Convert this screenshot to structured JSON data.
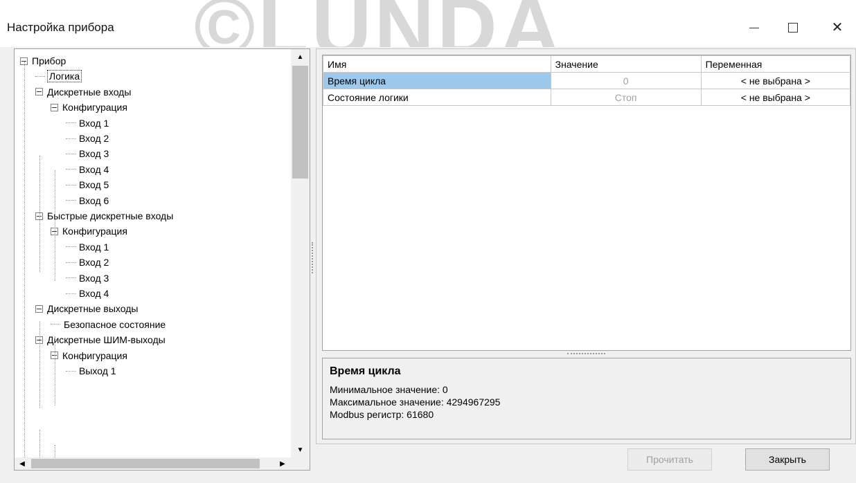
{
  "window": {
    "title": "Настройка прибора",
    "watermark": "©LUNDA"
  },
  "tree": {
    "items": [
      {
        "label": "Прибор",
        "level": 0,
        "expander": true
      },
      {
        "label": "Логика",
        "level": 1,
        "expander": false,
        "selected": true
      },
      {
        "label": "Дискретные входы",
        "level": 1,
        "expander": true
      },
      {
        "label": "Конфигурация",
        "level": 2,
        "expander": true
      },
      {
        "label": "Вход 1",
        "level": 3,
        "expander": false
      },
      {
        "label": "Вход 2",
        "level": 3,
        "expander": false
      },
      {
        "label": "Вход 3",
        "level": 3,
        "expander": false
      },
      {
        "label": "Вход 4",
        "level": 3,
        "expander": false
      },
      {
        "label": "Вход 5",
        "level": 3,
        "expander": false
      },
      {
        "label": "Вход 6",
        "level": 3,
        "expander": false
      },
      {
        "label": "Быстрые дискретные входы",
        "level": 1,
        "expander": true
      },
      {
        "label": "Конфигурация",
        "level": 2,
        "expander": true
      },
      {
        "label": "Вход 1",
        "level": 3,
        "expander": false
      },
      {
        "label": "Вход 2",
        "level": 3,
        "expander": false
      },
      {
        "label": "Вход 3",
        "level": 3,
        "expander": false
      },
      {
        "label": "Вход 4",
        "level": 3,
        "expander": false
      },
      {
        "label": "Дискретные выходы",
        "level": 1,
        "expander": true
      },
      {
        "label": "Безопасное состояние",
        "level": 2,
        "expander": false
      },
      {
        "label": "Дискретные ШИМ-выходы",
        "level": 1,
        "expander": true
      },
      {
        "label": "Конфигурация",
        "level": 2,
        "expander": true
      },
      {
        "label": "Выход 1",
        "level": 3,
        "expander": false
      }
    ]
  },
  "grid": {
    "columns": [
      "Имя",
      "Значение",
      "Переменная"
    ],
    "rows": [
      {
        "name": "Время цикла",
        "value": "0",
        "variable": "< не выбрана >",
        "selected": true
      },
      {
        "name": "Состояние логики",
        "value": "Стоп",
        "variable": "< не выбрана >",
        "selected": false
      }
    ]
  },
  "info": {
    "title": "Время цикла",
    "lines": [
      "Минимальное значение: 0",
      "Максимальное значение: 4294967295",
      "Modbus регистр: 61680"
    ]
  },
  "buttons": {
    "read": "Прочитать",
    "close": "Закрыть"
  },
  "icons": {
    "minimize": "minimize-icon",
    "maximize": "maximize-icon",
    "close": "close-icon"
  }
}
